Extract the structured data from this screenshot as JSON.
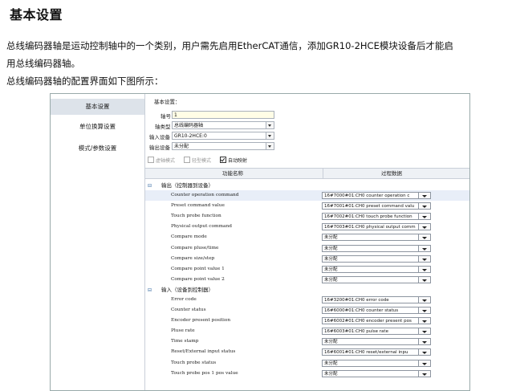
{
  "heading": "基本设置",
  "paragraphs": [
    "总线编码器轴是运动控制轴中的一个类别，用户需先启用EtherCAT通信，添加GR10-2HCE模块设备后才能启",
    "用总线编码器轴。",
    "总线编码器轴的配置界面如下图所示："
  ],
  "sidebar": {
    "items": [
      {
        "label": "基本设置",
        "active": true
      },
      {
        "label": "单位换算设置",
        "active": false
      },
      {
        "label": "模式/参数设置",
        "active": false
      }
    ]
  },
  "form": {
    "section_title": "基本设置：",
    "axis_no_label": "轴号",
    "axis_no_value": "1",
    "axis_type_label": "轴类型",
    "axis_type_value": "总线编码器轴",
    "input_dev_label": "输入设备",
    "input_dev_value": "GR10-2HCE:0",
    "output_dev_label": "输出设备",
    "output_dev_value": "未分配",
    "check_virtual": "虚轴模式",
    "check_simple": "轻型模式",
    "check_automap": "自动映射"
  },
  "table": {
    "col_function": "功能名称",
    "col_process": "过程数据",
    "group_output": "输出（控制器到设备）",
    "group_input": "输入（设备到控制器）",
    "output_rows": [
      {
        "name": "Counter operation command",
        "value": "16#7000#01:CH0 counter operation c"
      },
      {
        "name": "Preset command value",
        "value": "16#7001#01:CH0 preset command valu"
      },
      {
        "name": "Touch probe function",
        "value": "16#7002#01:CH0 touch probe function"
      },
      {
        "name": "Physical output command",
        "value": "16#7003#01:CH0 physical output comm"
      },
      {
        "name": "Compare mode",
        "value": "未分配"
      },
      {
        "name": "Compare pluse/time",
        "value": "未分配"
      },
      {
        "name": "Compare size/step",
        "value": "未分配"
      },
      {
        "name": "Compare point value 1",
        "value": "未分配"
      },
      {
        "name": "Compare point value 2",
        "value": "未分配"
      }
    ],
    "input_rows": [
      {
        "name": "Error code",
        "value": "16#3200#01:CH0 error code"
      },
      {
        "name": "Counter status",
        "value": "16#6000#01:CH0 counter status"
      },
      {
        "name": "Encoder present position",
        "value": "16#6002#01:CH0 encoder present pos"
      },
      {
        "name": "Pluse rate",
        "value": "16#6003#01:CH0 pulse rate"
      },
      {
        "name": "Time stamp",
        "value": "未分配"
      },
      {
        "name": "Reset/External input status",
        "value": "16#6001#01:CH0 reset/external inpu"
      },
      {
        "name": "Touch probe status",
        "value": "未分配"
      },
      {
        "name": "Touch probe pos 1 pos value",
        "value": "未分配"
      }
    ]
  }
}
